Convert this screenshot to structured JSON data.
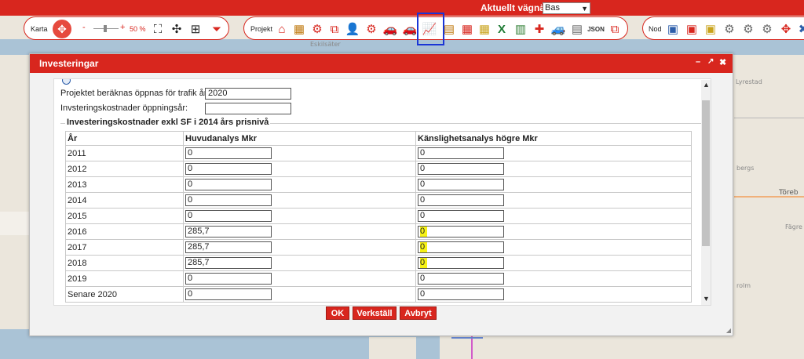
{
  "header": {
    "route_label": "Aktuellt vägnät:",
    "route_value": "Bas"
  },
  "toolbar": {
    "karta_label": "Karta",
    "zoom_minus": "-",
    "zoom_plus": "+",
    "zoom_value": "50 %",
    "projekt_label": "Projekt",
    "nod_label": "Nod"
  },
  "dialog": {
    "title": "Investeringar",
    "minimize": "–",
    "restore": "↗",
    "close": "✖",
    "opening_year_label": "Projektet beräknas öppnas för trafik år",
    "opening_year_value": "2020",
    "opening_cost_label": "Invsteringskostnader öppningsår:",
    "opening_cost_value": "",
    "fieldset_title": "Investeringskostnader exkl SF i 2014 års prisnivå",
    "columns": [
      "År",
      "Huvudanalys Mkr",
      "Känslighetsanalys högre Mkr"
    ],
    "rows": [
      {
        "year": "2011",
        "main": "0",
        "sens": "0",
        "highlight": false
      },
      {
        "year": "2012",
        "main": "0",
        "sens": "0",
        "highlight": false
      },
      {
        "year": "2013",
        "main": "0",
        "sens": "0",
        "highlight": false
      },
      {
        "year": "2014",
        "main": "0",
        "sens": "0",
        "highlight": false
      },
      {
        "year": "2015",
        "main": "0",
        "sens": "0",
        "highlight": false
      },
      {
        "year": "2016",
        "main": "285,7",
        "sens": "0",
        "highlight": true
      },
      {
        "year": "2017",
        "main": "285,7",
        "sens": "0",
        "highlight": true
      },
      {
        "year": "2018",
        "main": "285,7",
        "sens": "0",
        "highlight": true
      },
      {
        "year": "2019",
        "main": "0",
        "sens": "0",
        "highlight": false
      },
      {
        "year": "Senare 2020",
        "main": "0",
        "sens": "0",
        "highlight": false
      }
    ],
    "buttons": {
      "ok": "OK",
      "apply": "Verkställ",
      "cancel": "Avbryt"
    }
  },
  "map_labels": {
    "town": "Töreb",
    "fagre": "Fägre",
    "lyrestad": "Lyrestad",
    "bergs": "bergs",
    "rolm": "rolm",
    "eskilsater": "Eskilsäter"
  },
  "colors": {
    "accent": "#d8261e",
    "highlight": "#f6f215",
    "focus": "#1a35d6"
  }
}
